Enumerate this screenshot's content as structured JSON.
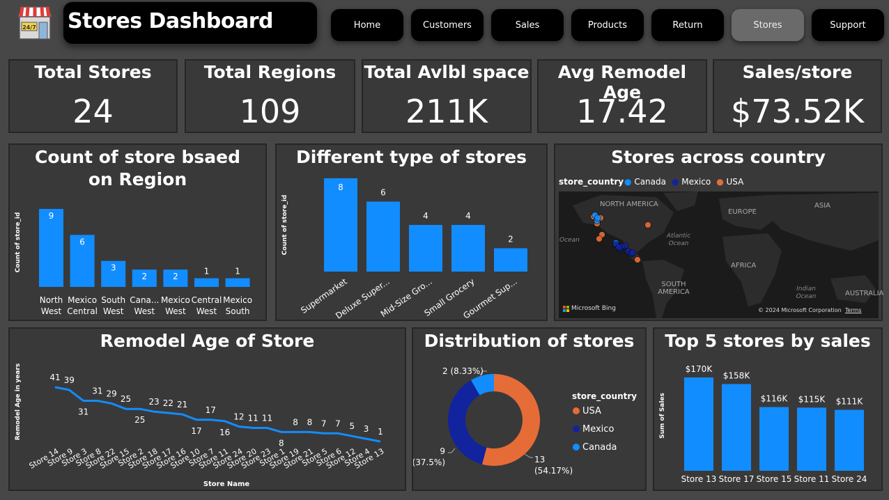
{
  "header": {
    "title": "Stores Dashboard",
    "logo_text": "24/7",
    "nav": [
      {
        "label": "Home"
      },
      {
        "label": "Customers"
      },
      {
        "label": "Sales"
      },
      {
        "label": "Products"
      },
      {
        "label": "Return"
      },
      {
        "label": "Stores",
        "active": true
      },
      {
        "label": "Support"
      }
    ]
  },
  "kpis": [
    {
      "title": "Total Stores",
      "value": "24"
    },
    {
      "title": "Total Regions",
      "value": "109"
    },
    {
      "title": "Total Avlbl space",
      "value": "211K"
    },
    {
      "title": "Avg Remodel Age",
      "value": "17.42"
    },
    {
      "title": "Sales/store",
      "value": "$73.52K"
    }
  ],
  "colors": {
    "bar": "#118dff",
    "usa": "#e66c37",
    "mexico": "#12239e",
    "canada": "#118dff",
    "panel_bg": "#3a3939"
  },
  "map": {
    "title": "Stores across country",
    "legend_title": "store_country",
    "legend": [
      "Canada",
      "Mexico",
      "USA"
    ],
    "labels": [
      "NORTH AMERICA",
      "EUROPE",
      "ASIA",
      "Atlantic Ocean",
      "AFRICA",
      "SOUTH AMERICA",
      "Indian Ocean",
      "AUSTRALIA",
      "Ocean"
    ],
    "attribution": "© 2024 Microsoft Corporation",
    "terms": "Terms",
    "bing": "Microsoft Bing"
  },
  "chart_data": [
    {
      "type": "bar",
      "title": "Count of store bsaed on Region",
      "ylabel": "Count of store_id",
      "categories": [
        "North West",
        "Mexico Central",
        "South West",
        "Cana... West",
        "Mexico West",
        "Central West",
        "Mexico South"
      ],
      "values": [
        9,
        6,
        3,
        2,
        2,
        1,
        1
      ],
      "ylim": [
        0,
        9
      ]
    },
    {
      "type": "bar",
      "title": "Different type of stores",
      "ylabel": "Count of store_id",
      "categories": [
        "Supermarket",
        "Deluxe Super...",
        "Mid-Size Gro...",
        "Small Grocery",
        "Gourmet Sup..."
      ],
      "values": [
        8,
        6,
        4,
        4,
        2
      ],
      "ylim": [
        0,
        8
      ]
    },
    {
      "type": "line",
      "title": "Remodel Age of Store",
      "xlabel": "Store Name",
      "ylabel": "Remodel Age in years",
      "categories": [
        "Store 14",
        "Store 9",
        "Store 3",
        "Store 8",
        "Store 22",
        "Store 15",
        "Store 2",
        "Store 18",
        "Store 17",
        "Store 16",
        "Store 10",
        "Store 7",
        "Store 11",
        "Store 24",
        "Store 20",
        "Store 23",
        "Store 1",
        "Store 19",
        "Store 21",
        "Store 5",
        "Store 6",
        "Store 12",
        "Store 4",
        "Store 13"
      ],
      "values": [
        41,
        39,
        31,
        31,
        29,
        25,
        25,
        23,
        22,
        21,
        17,
        17,
        16,
        12,
        11,
        11,
        8,
        8,
        8,
        7,
        7,
        5,
        3,
        1
      ],
      "ylim": [
        0,
        41
      ]
    },
    {
      "type": "pie",
      "title": "Distribution of stores",
      "legend_title": "store_country",
      "slices": [
        {
          "name": "USA",
          "value": 13,
          "label": "13",
          "pct": "(54.17%)"
        },
        {
          "name": "Mexico",
          "value": 9,
          "label": "9",
          "pct": "(37.5%)"
        },
        {
          "name": "Canada",
          "value": 2,
          "label": "2",
          "pct": "(8.33%)"
        }
      ]
    },
    {
      "type": "bar",
      "title": "Top 5 stores by sales",
      "ylabel": "Sum of Sales",
      "categories": [
        "Store 13",
        "Store 17",
        "Store 15",
        "Store 11",
        "Store 24"
      ],
      "values": [
        170,
        158,
        116,
        115,
        111
      ],
      "labels": [
        "$170K",
        "$158K",
        "$116K",
        "$115K",
        "$111K"
      ],
      "ylim": [
        0,
        170
      ]
    }
  ]
}
